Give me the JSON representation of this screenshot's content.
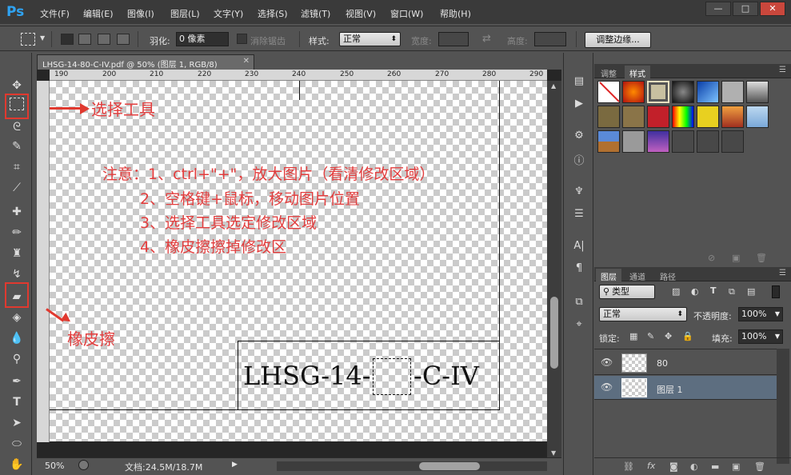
{
  "app": {
    "logo": "Ps",
    "menu": [
      "文件(F)",
      "编辑(E)",
      "图像(I)",
      "图层(L)",
      "文字(Y)",
      "选择(S)",
      "滤镜(T)",
      "视图(V)",
      "窗口(W)",
      "帮助(H)"
    ],
    "window_controls": {
      "minimize": "—",
      "restore": "□",
      "close": "✕"
    }
  },
  "options": {
    "feather_label": "羽化:",
    "feather_value": "0 像素",
    "antialias_label": "消除锯齿",
    "style_label": "样式:",
    "style_value": "正常",
    "width_label": "宽度:",
    "height_label": "高度:",
    "refine_button": "调整边缘..."
  },
  "document": {
    "tab_title": "LHSG-14-80-C-IV.pdf @ 50% (图层 1, RGB/8)",
    "ruler_ticks": [
      "190",
      "200",
      "210",
      "220",
      "230",
      "240",
      "250",
      "260",
      "270",
      "280",
      "290"
    ],
    "zoom": "50%",
    "doc_size": "文档:24.5M/18.7M"
  },
  "canvas": {
    "notes": [
      "注意：1、ctrl+\"+\"，放大图片（看清修改区域）",
      "2、空格键+鼠标，移动图片位置",
      "3、选择工具选定修改区域",
      "4、橡皮擦擦掉修改区"
    ],
    "drawing_label_left": "LHSG-14-",
    "drawing_label_right": "-C-IV"
  },
  "annotations": {
    "select_tool": "选择工具",
    "eraser": "橡皮擦"
  },
  "panels": {
    "styles_tabs": [
      "调整",
      "样式"
    ],
    "layers_tabs": [
      "图层",
      "通道",
      "路径"
    ],
    "filter_kind": "类型",
    "blend_mode": "正常",
    "opacity_label": "不透明度:",
    "opacity_value": "100%",
    "lock_label": "锁定:",
    "fill_label": "填充:",
    "fill_value": "100%",
    "layers": [
      {
        "name": "80",
        "visible": true,
        "selected": false
      },
      {
        "name": "图层 1",
        "visible": true,
        "selected": true
      }
    ]
  }
}
